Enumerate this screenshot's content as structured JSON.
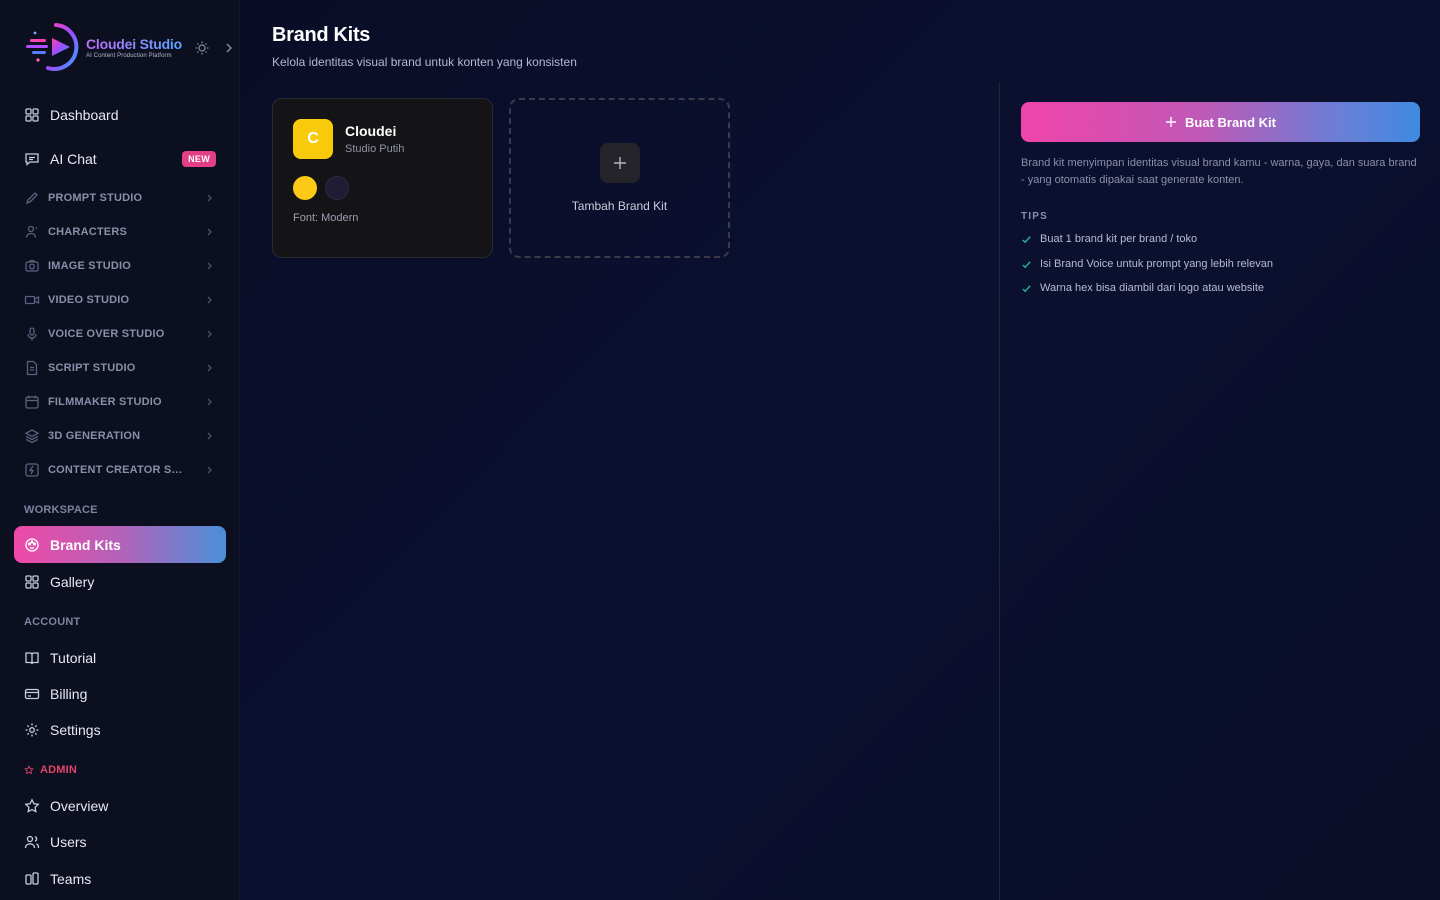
{
  "brand": {
    "name": "Cloudei Studio",
    "tagline": "AI Content Production Platform"
  },
  "sidebar": {
    "dashboard": "Dashboard",
    "ai_chat": "AI Chat",
    "ai_chat_badge": "NEW",
    "sections": [
      {
        "label": "PROMPT STUDIO",
        "icon": "pen-icon"
      },
      {
        "label": "CHARACTERS",
        "icon": "user-icon"
      },
      {
        "label": "IMAGE STUDIO",
        "icon": "camera-icon"
      },
      {
        "label": "VIDEO STUDIO",
        "icon": "video-icon"
      },
      {
        "label": "VOICE OVER STUDIO",
        "icon": "mic-icon"
      },
      {
        "label": "SCRIPT STUDIO",
        "icon": "document-icon"
      },
      {
        "label": "FILMMAKER STUDIO",
        "icon": "calendar-icon"
      },
      {
        "label": "3D GENERATION",
        "icon": "layers-icon"
      },
      {
        "label": "CONTENT CREATOR STUDIO",
        "icon": "bolt-icon"
      }
    ],
    "workspace_label": "WORKSPACE",
    "workspace": [
      {
        "label": "Brand Kits",
        "icon": "palette-icon",
        "active": true
      },
      {
        "label": "Gallery",
        "icon": "grid-icon"
      }
    ],
    "account_label": "ACCOUNT",
    "account": [
      {
        "label": "Tutorial",
        "icon": "book-icon"
      },
      {
        "label": "Billing",
        "icon": "card-icon"
      },
      {
        "label": "Settings",
        "icon": "gear-icon"
      }
    ],
    "admin_label": "ADMIN",
    "admin": [
      {
        "label": "Overview",
        "icon": "star-icon"
      },
      {
        "label": "Users",
        "icon": "users-icon"
      },
      {
        "label": "Teams",
        "icon": "teams-icon"
      }
    ]
  },
  "page": {
    "title": "Brand Kits",
    "subtitle": "Kelola identitas visual brand untuk konten yang konsisten"
  },
  "kits": [
    {
      "initial": "C",
      "name": "Cloudei",
      "description": "Studio Putih",
      "colors": [
        "#fcc916",
        "#1f1d33"
      ],
      "font": "Font: Modern"
    }
  ],
  "add_kit": {
    "label": "Tambah Brand Kit"
  },
  "panel": {
    "create_button": "Buat Brand Kit",
    "info": "Brand kit menyimpan identitas visual brand kamu - warna, gaya, dan suara brand - yang otomatis dipakai saat generate konten.",
    "tips_title": "TIPS",
    "tips": [
      "Buat 1 brand kit per brand / toko",
      "Isi Brand Voice untuk prompt yang lebih relevan",
      "Warna hex bisa diambil dari logo atau website"
    ]
  },
  "colors": {
    "accent_pink": "#f044aa",
    "accent_blue": "#3e8ae0",
    "badge": "#e23f86",
    "admin": "#e0456a",
    "tip_check": "#29b39a"
  }
}
